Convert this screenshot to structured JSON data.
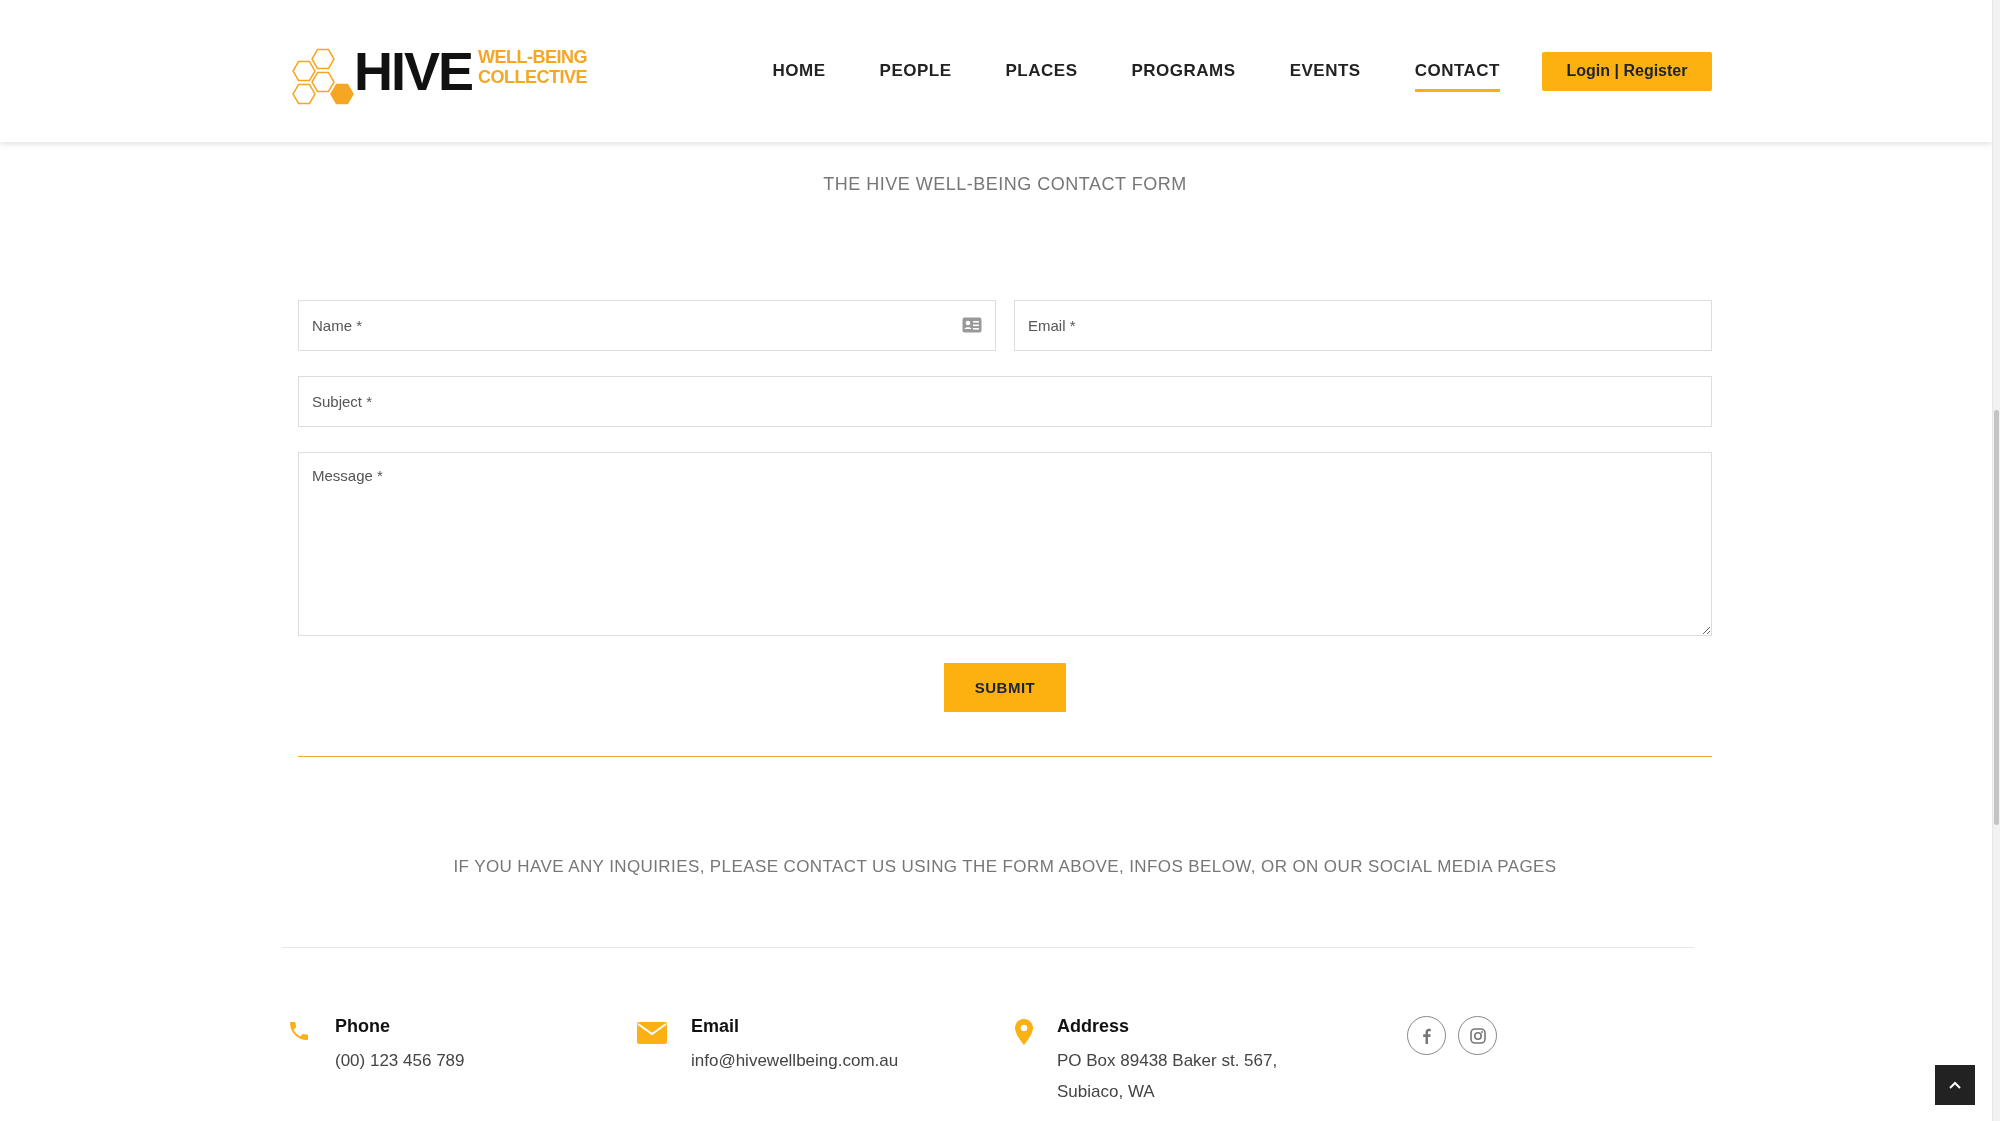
{
  "logo": {
    "wordmark": "HIVE",
    "tagline_lines": [
      "WELL-BEING",
      "COLLECTIVE"
    ]
  },
  "nav": [
    {
      "label": "HOME",
      "selected": false
    },
    {
      "label": "PEOPLE",
      "selected": false
    },
    {
      "label": "PLACES",
      "selected": false
    },
    {
      "label": "PROGRAMS",
      "selected": false
    },
    {
      "label": "EVENTS",
      "selected": false
    },
    {
      "label": "CONTACT",
      "selected": true
    }
  ],
  "login_button": "Login | Register",
  "form": {
    "title": "THE HIVE WELL-BEING CONTACT FORM",
    "rows": [
      [
        {
          "kind": "input",
          "placeholder": "Name *",
          "has_icon": true
        },
        {
          "kind": "input",
          "placeholder": "Email *",
          "has_icon": false
        }
      ],
      [
        {
          "kind": "input",
          "placeholder": "Subject *",
          "has_icon": false
        }
      ],
      [
        {
          "kind": "textarea",
          "placeholder": "Message *",
          "has_icon": false
        }
      ]
    ],
    "submit": "SUBMIT"
  },
  "inquiry_note": "IF YOU HAVE ANY INQUIRIES, PLEASE CONTACT US USING THE FORM ABOVE, INFOS BELOW, OR ON OUR SOCIAL MEDIA PAGES",
  "contacts": [
    {
      "kind": "phone",
      "label": "Phone",
      "lines": [
        "(00) 123 456 789"
      ]
    },
    {
      "kind": "email",
      "label": "Email",
      "lines": [
        "info@hivewellbeing.com.au"
      ]
    },
    {
      "kind": "address",
      "label": "Address",
      "lines": [
        "PO Box 89438 Baker st. 567,",
        "Subiaco, WA"
      ]
    }
  ],
  "social": [
    {
      "kind": "facebook"
    },
    {
      "kind": "instagram"
    }
  ]
}
